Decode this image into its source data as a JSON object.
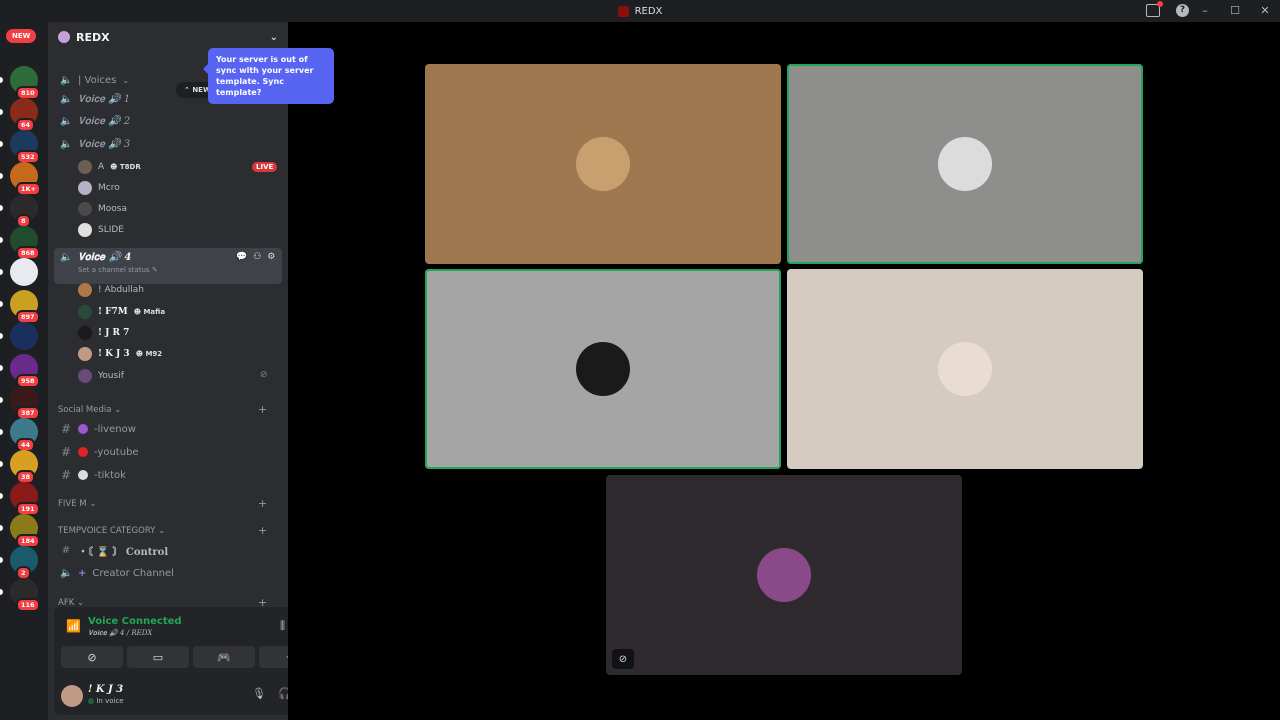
{
  "window": {
    "title": "REDX",
    "controls": [
      "–",
      "☐",
      "✕"
    ]
  },
  "rail": {
    "new_label": "NEW",
    "guilds": [
      {
        "count": "810",
        "color": "#2d6b3a"
      },
      {
        "count": "64",
        "color": "#8a2a1a"
      },
      {
        "count": "532",
        "color": "#1c3a5e"
      },
      {
        "count": "1K+",
        "color": "#c46a1a"
      },
      {
        "count": "8",
        "color": "#2a2a2a"
      },
      {
        "count": "868",
        "color": "#1f4d2e"
      },
      {
        "count": "",
        "color": "#e8eaf0"
      },
      {
        "count": "897",
        "color": "#c9a020"
      },
      {
        "count": "",
        "color": "#1a2f5c"
      },
      {
        "count": "958",
        "color": "#6a2a8a"
      },
      {
        "count": "387",
        "color": "#3a1a1a"
      },
      {
        "count": "44",
        "color": "#3c7a8a"
      },
      {
        "count": "38",
        "color": "#d8a020"
      },
      {
        "count": "191",
        "color": "#8a1a1a"
      },
      {
        "count": "184",
        "color": "#8a7a1a"
      },
      {
        "count": "2",
        "color": "#1a5a6a"
      },
      {
        "count": "116",
        "color": "#2a2a2a"
      }
    ]
  },
  "server": {
    "name": "REDX",
    "new_unreads": "NEW UNREADS",
    "tooltip": "Your server is out of sync with your server template. Sync template?"
  },
  "channels": {
    "voices_cat": "| Voices",
    "voice1": "𝐕𝐨𝐢𝐜𝐞 🔊 1",
    "voice2": "𝐕𝐨𝐢𝐜𝐞 🔊 2",
    "voice3": "𝐕𝐨𝐢𝐜𝐞 🔊 3",
    "voice3_members": [
      {
        "name": "A",
        "tag": "T8DR",
        "live": "LIVE",
        "color": "#6b5e55"
      },
      {
        "name": "Mcro",
        "tag": "",
        "live": "",
        "color": "#b8b0c8"
      },
      {
        "name": "Moosa",
        "tag": "",
        "live": "",
        "color": "#4a4a4a"
      },
      {
        "name": "SLIDE",
        "tag": "",
        "live": "",
        "color": "#e0e0e0"
      }
    ],
    "voice4": "𝐕𝐨𝐢𝐜𝐞 🔊 4",
    "voice4_status": "Set a channel status",
    "voice4_members": [
      {
        "name": "! Abdullah",
        "tag": "",
        "color": "#b07848"
      },
      {
        "name": "! F7M",
        "tag": "Mafia",
        "color": "#2a4a3a"
      },
      {
        "name": "! J R 7",
        "tag": "",
        "color": "#1a1a1a"
      },
      {
        "name": "! K J 3",
        "tag": "M92",
        "color": "#c19a86"
      },
      {
        "name": "Yousif",
        "tag": "",
        "color": "#6a4a7a"
      }
    ],
    "social_cat": "Social Media",
    "social": [
      "-livenow",
      "-youtube",
      "-tiktok"
    ],
    "social_dot_colors": [
      "#9b59d0",
      "#e02424",
      "#dbdee1"
    ],
    "fivem_cat": "FIVE M",
    "tempvoice_cat": "TEMPVOICE CATEGORY",
    "control": "・〘 ⌛ 〙 Control",
    "creator": "Creator Channel",
    "afk_cat": "AFK"
  },
  "voice_panel": {
    "status": "Voice Connected",
    "sub": "𝐕𝐨𝐢𝐜𝐞 🔊 4 / REDX"
  },
  "user": {
    "name": "! K J 3",
    "status": "In voice"
  },
  "tiles": [
    {
      "bg": "#a07850",
      "speaking": false,
      "avatar": "#c8a070",
      "muted": false
    },
    {
      "bg": "#8e8f8c",
      "speaking": true,
      "avatar": "#dcdcdc",
      "muted": false
    },
    {
      "bg": "#a5a5a5",
      "speaking": true,
      "avatar": "#1a1a1a",
      "muted": false
    },
    {
      "bg": "#d6cbc0",
      "speaking": false,
      "avatar": "#e8ddd0",
      "muted": false
    },
    {
      "bg": "#2e2a2e",
      "speaking": false,
      "avatar": "#8a4a8a",
      "muted": true
    }
  ]
}
